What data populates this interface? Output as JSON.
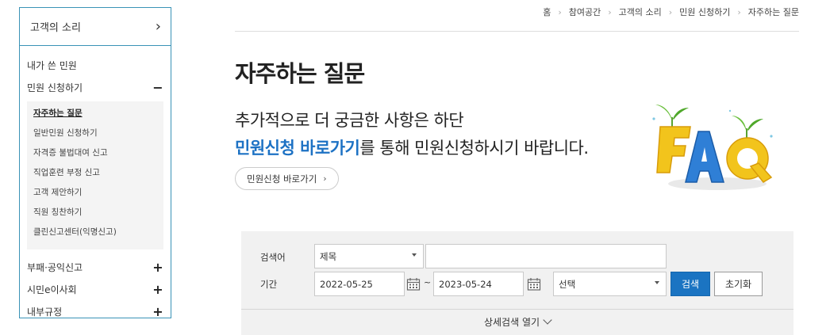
{
  "sidebar": {
    "header": "고객의 소리",
    "header_icon": "chevron-right-icon",
    "items": [
      {
        "label": "내가 쓴 민원"
      },
      {
        "label": "민원 신청하기",
        "sign": "−"
      }
    ],
    "submenu": [
      {
        "label": "자주하는 질문",
        "active": true
      },
      {
        "label": "일반민원 신청하기"
      },
      {
        "label": "자격증 불법대여 신고"
      },
      {
        "label": "직업훈련 부정 신고"
      },
      {
        "label": "고객 제안하기"
      },
      {
        "label": "직원 칭찬하기"
      },
      {
        "label": "클린신고센터(익명신고)"
      }
    ],
    "bottom": [
      {
        "label": "부패·공익신고",
        "sign": "+"
      },
      {
        "label": "시민e이사회",
        "sign": "+"
      },
      {
        "label": "내부규정",
        "sign": "+"
      }
    ]
  },
  "breadcrumb": [
    "홈",
    "참여공간",
    "고객의 소리",
    "민원 신청하기",
    "자주하는 질문"
  ],
  "page_title": "자주하는 질문",
  "intro": {
    "line1": "추가적으로 더 궁금한 사항은 하단",
    "line2_highlight": "민원신청 바로가기",
    "line2_rest": "를 통해 민원신청하시기 바랍니다.",
    "button_label": "민원신청 바로가기",
    "button_arrow": "›"
  },
  "search": {
    "keyword_label": "검색어",
    "keyword_select": "제목",
    "keyword_value": "",
    "period_label": "기간",
    "date_from": "2022-05-25",
    "tilde": "~",
    "date_to": "2023-05-24",
    "period_select": "선택",
    "search_button": "검색",
    "reset_button": "초기화",
    "detail_toggle": "상세검색 열기"
  },
  "colors": {
    "accent_blue": "#1b74c2",
    "highlight_text": "#1d72c4",
    "sidebar_border": "#3a93b6",
    "panel_bg": "#f1f1f1"
  }
}
